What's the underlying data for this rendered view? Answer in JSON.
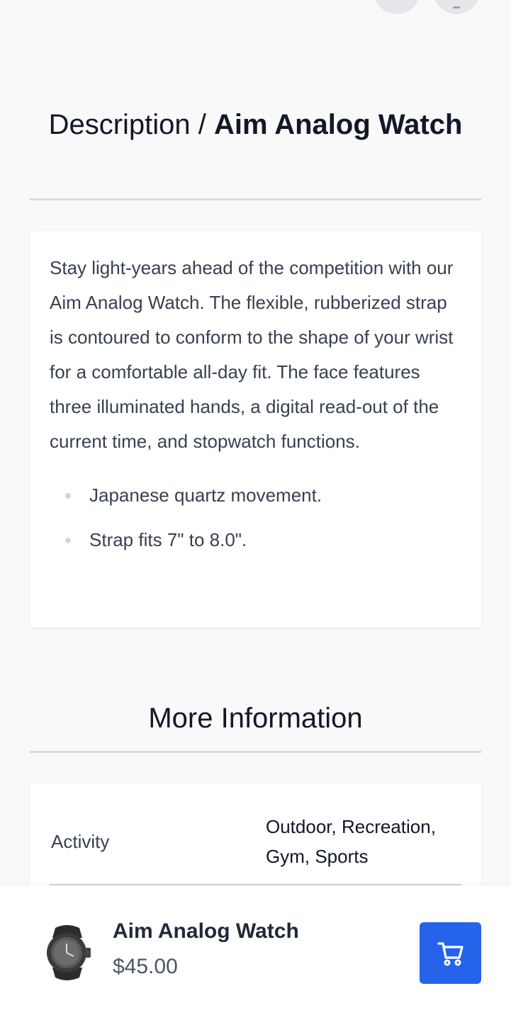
{
  "description": {
    "title_prefix": "Description / ",
    "title_product": "Aim Analog Watch",
    "body": "Stay light-years ahead of the competition with our Aim Analog Watch. The flexible, rubberized strap is contoured to conform to the shape of your wrist for a comfortable all-day fit. The face features three illuminated hands, a digital read-out of the current time, and stopwatch functions.",
    "bullets": [
      "Japanese quartz movement.",
      "Strap fits 7\" to 8.0\"."
    ]
  },
  "more_info": {
    "title": "More Information",
    "rows": [
      {
        "label": "Activity",
        "value": "Outdoor, Recreation, Gym, Sports"
      }
    ]
  },
  "bottom_bar": {
    "product_name": "Aim Analog Watch",
    "price": "$45.00",
    "cart_icon": "shopping-cart-icon",
    "accent_color": "#2563eb"
  }
}
